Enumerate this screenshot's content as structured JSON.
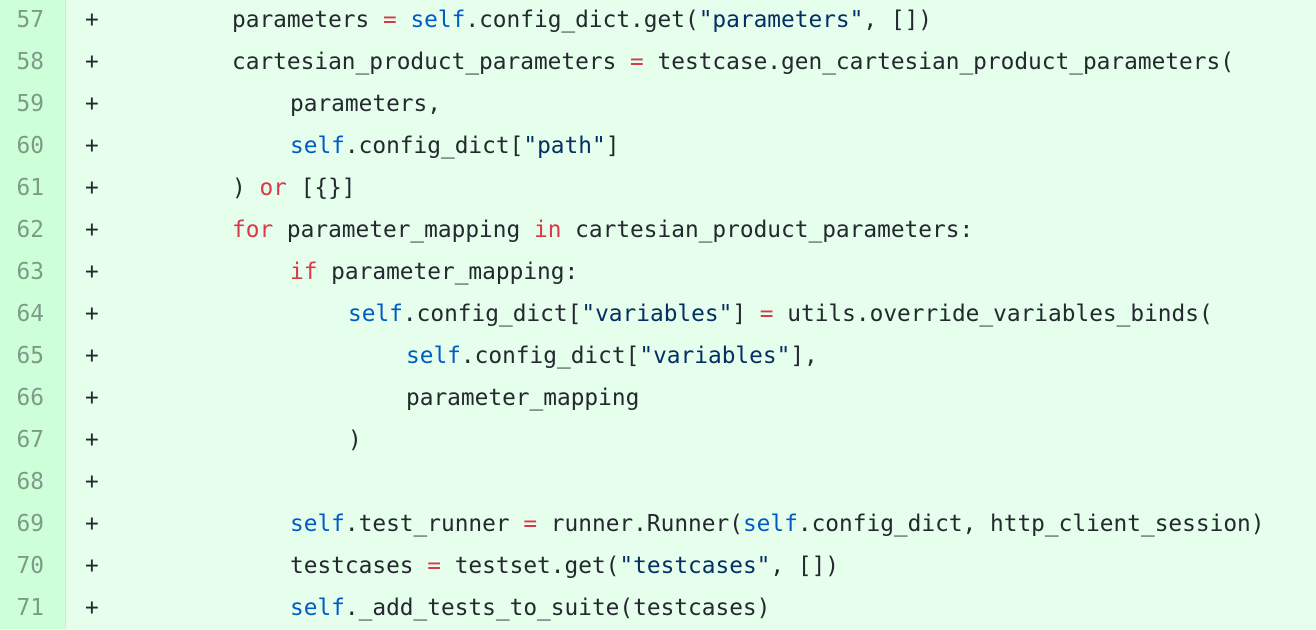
{
  "colors": {
    "background": "#e6ffed",
    "gutter": "#cdffd8",
    "keyword": "#d73a49",
    "builtin_self": "#005cc5",
    "string": "#032f62",
    "text": "#24292e"
  },
  "lines": [
    {
      "num": "57",
      "marker": "+",
      "indent": 2,
      "tokens": [
        {
          "t": "parameters ",
          "k": "plain"
        },
        {
          "t": "=",
          "k": "op"
        },
        {
          "t": " ",
          "k": "plain"
        },
        {
          "t": "self",
          "k": "self"
        },
        {
          "t": ".config_dict.get(",
          "k": "plain"
        },
        {
          "t": "\"parameters\"",
          "k": "str"
        },
        {
          "t": ", [])",
          "k": "plain"
        }
      ]
    },
    {
      "num": "58",
      "marker": "+",
      "indent": 2,
      "tokens": [
        {
          "t": "cartesian_product_parameters ",
          "k": "plain"
        },
        {
          "t": "=",
          "k": "op"
        },
        {
          "t": " testcase.gen_cartesian_product_parameters(",
          "k": "plain"
        }
      ]
    },
    {
      "num": "59",
      "marker": "+",
      "indent": 3,
      "tokens": [
        {
          "t": "parameters,",
          "k": "plain"
        }
      ]
    },
    {
      "num": "60",
      "marker": "+",
      "indent": 3,
      "tokens": [
        {
          "t": "self",
          "k": "self"
        },
        {
          "t": ".config_dict[",
          "k": "plain"
        },
        {
          "t": "\"path\"",
          "k": "str"
        },
        {
          "t": "]",
          "k": "plain"
        }
      ]
    },
    {
      "num": "61",
      "marker": "+",
      "indent": 2,
      "tokens": [
        {
          "t": ") ",
          "k": "plain"
        },
        {
          "t": "or",
          "k": "kw"
        },
        {
          "t": " [{}]",
          "k": "plain"
        }
      ]
    },
    {
      "num": "62",
      "marker": "+",
      "indent": 2,
      "tokens": [
        {
          "t": "for",
          "k": "kw"
        },
        {
          "t": " parameter_mapping ",
          "k": "plain"
        },
        {
          "t": "in",
          "k": "kw"
        },
        {
          "t": " cartesian_product_parameters:",
          "k": "plain"
        }
      ]
    },
    {
      "num": "63",
      "marker": "+",
      "indent": 3,
      "tokens": [
        {
          "t": "if",
          "k": "kw"
        },
        {
          "t": " parameter_mapping:",
          "k": "plain"
        }
      ]
    },
    {
      "num": "64",
      "marker": "+",
      "indent": 4,
      "tokens": [
        {
          "t": "self",
          "k": "self"
        },
        {
          "t": ".config_dict[",
          "k": "plain"
        },
        {
          "t": "\"variables\"",
          "k": "str"
        },
        {
          "t": "] ",
          "k": "plain"
        },
        {
          "t": "=",
          "k": "op"
        },
        {
          "t": " utils.override_variables_binds(",
          "k": "plain"
        }
      ]
    },
    {
      "num": "65",
      "marker": "+",
      "indent": 5,
      "tokens": [
        {
          "t": "self",
          "k": "self"
        },
        {
          "t": ".config_dict[",
          "k": "plain"
        },
        {
          "t": "\"variables\"",
          "k": "str"
        },
        {
          "t": "],",
          "k": "plain"
        }
      ]
    },
    {
      "num": "66",
      "marker": "+",
      "indent": 5,
      "tokens": [
        {
          "t": "parameter_mapping",
          "k": "plain"
        }
      ]
    },
    {
      "num": "67",
      "marker": "+",
      "indent": 4,
      "tokens": [
        {
          "t": ")",
          "k": "plain"
        }
      ]
    },
    {
      "num": "68",
      "marker": "+",
      "indent": 0,
      "tokens": []
    },
    {
      "num": "69",
      "marker": "+",
      "indent": 3,
      "tokens": [
        {
          "t": "self",
          "k": "self"
        },
        {
          "t": ".test_runner ",
          "k": "plain"
        },
        {
          "t": "=",
          "k": "op"
        },
        {
          "t": " runner.Runner(",
          "k": "plain"
        },
        {
          "t": "self",
          "k": "self"
        },
        {
          "t": ".config_dict, http_client_session)",
          "k": "plain"
        }
      ]
    },
    {
      "num": "70",
      "marker": "+",
      "indent": 3,
      "tokens": [
        {
          "t": "testcases ",
          "k": "plain"
        },
        {
          "t": "=",
          "k": "op"
        },
        {
          "t": " testset.get(",
          "k": "plain"
        },
        {
          "t": "\"testcases\"",
          "k": "str"
        },
        {
          "t": ", [])",
          "k": "plain"
        }
      ]
    },
    {
      "num": "71",
      "marker": "+",
      "indent": 3,
      "tokens": [
        {
          "t": "self",
          "k": "self"
        },
        {
          "t": "._add_tests_to_suite(testcases)",
          "k": "plain"
        }
      ]
    }
  ]
}
